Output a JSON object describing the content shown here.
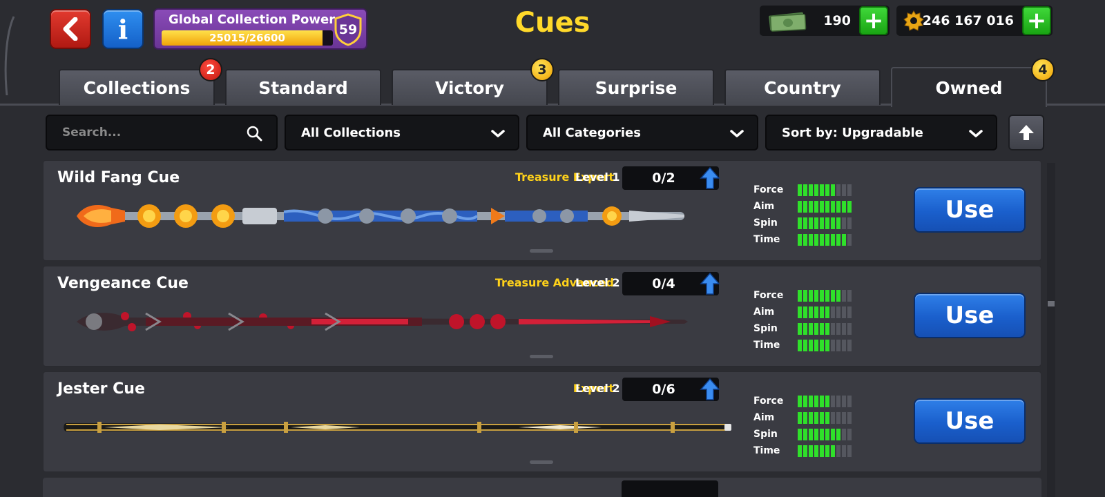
{
  "header": {
    "title": "Cues",
    "global_power": {
      "label": "Global Collection Power",
      "progress_text": "25015/26600",
      "progress_fraction": 0.94,
      "level": "59"
    },
    "cash": "190",
    "coins": "246 167 016"
  },
  "tabs": [
    {
      "label": "Collections",
      "badge": "2",
      "badge_color": "red"
    },
    {
      "label": "Standard"
    },
    {
      "label": "Victory",
      "badge": "3",
      "badge_color": "yellow"
    },
    {
      "label": "Surprise"
    },
    {
      "label": "Country"
    },
    {
      "label": "Owned",
      "badge": "4",
      "badge_color": "yellow",
      "active": true
    }
  ],
  "filters": {
    "search_placeholder": "Search...",
    "collections": "All Collections",
    "categories": "All Categories",
    "sort": "Sort by: Upgradable"
  },
  "stat_labels": [
    "Force",
    "Aim",
    "Spin",
    "Time"
  ],
  "cues": [
    {
      "name": "Wild Fang Cue",
      "category": "Treasure Expert",
      "level": "Level 1",
      "progress": "0/2",
      "stats": {
        "force": 7,
        "aim": 10,
        "spin": 8,
        "time": 9
      },
      "action": "Use"
    },
    {
      "name": "Vengeance Cue",
      "category": "Treasure Advanced",
      "level": "Level 2",
      "progress": "0/4",
      "stats": {
        "force": 8,
        "aim": 6,
        "spin": 6,
        "time": 6
      },
      "action": "Use"
    },
    {
      "name": "Jester Cue",
      "category": "Expert",
      "level": "Level 2",
      "progress": "0/6",
      "stats": {
        "force": 6,
        "aim": 6,
        "spin": 8,
        "time": 7
      },
      "action": "Use"
    }
  ],
  "colors": {
    "accent_yellow": "#ffd92a",
    "stat_on": "#2fe02a",
    "use_button": "#1a5fcc"
  }
}
